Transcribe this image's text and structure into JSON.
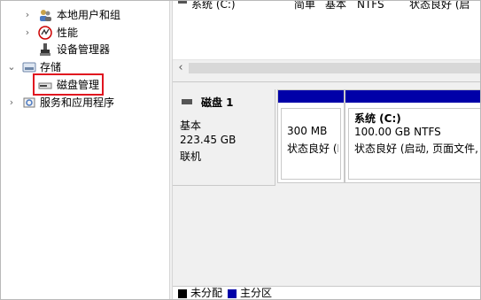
{
  "tree": {
    "items": [
      {
        "label": "本地用户和组",
        "expandable": true,
        "icon": "users-icon"
      },
      {
        "label": "性能",
        "expandable": true,
        "icon": "performance-icon"
      },
      {
        "label": "设备管理器",
        "expandable": false,
        "icon": "device-manager-icon"
      },
      {
        "label": "存储",
        "expandable": true,
        "expanded": true,
        "icon": "storage-icon"
      },
      {
        "label": "磁盘管理",
        "expandable": false,
        "selected": true,
        "icon": "disk-management-icon"
      },
      {
        "label": "服务和应用程序",
        "expandable": true,
        "icon": "services-icon"
      }
    ]
  },
  "volume_list": {
    "row": {
      "name": "系统 (C:)",
      "layout": "简单",
      "type": "基本",
      "filesystem": "NTFS",
      "status": "状态良好 (启"
    }
  },
  "disk": {
    "title": "磁盘 1",
    "type": "基本",
    "size": "223.45 GB",
    "status": "联机"
  },
  "partitions": [
    {
      "line1": "300 MB",
      "line2": "状态良好 (E"
    },
    {
      "name": "系统   (C:)",
      "line1": "100.00 GB NTFS",
      "line2": "状态良好 (启动, 页面文件,"
    }
  ],
  "legend": {
    "unallocated": "未分配",
    "primary": "主分区"
  },
  "colors": {
    "primary_partition": "#0000a8",
    "unallocated": "#000000",
    "highlight_border": "#e0141f"
  }
}
